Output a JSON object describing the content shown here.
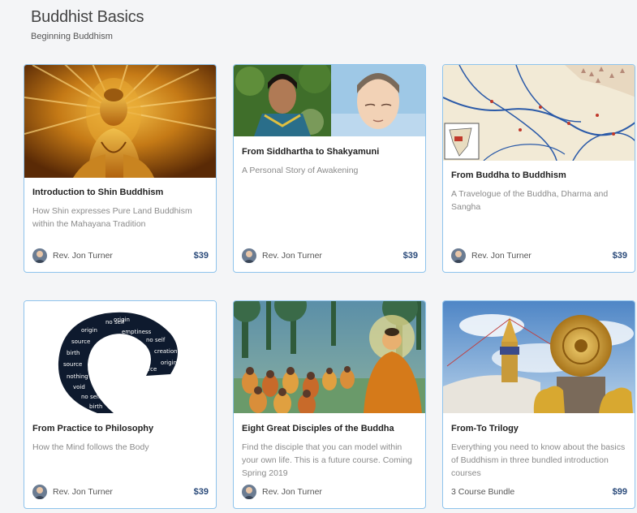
{
  "page": {
    "title": "Buddhist Basics",
    "subtitle": "Beginning Buddhism"
  },
  "courses": [
    {
      "title": "Introduction to Shin Buddhism",
      "description": "How Shin expresses Pure Land Buddhism within the Mahayana Tradition",
      "author": "Rev. Jon Turner",
      "price": "$39",
      "image": "golden-buddha-image"
    },
    {
      "title": "From Siddhartha to Shakyamuni",
      "description": "A Personal Story of Awakening",
      "author": "Rev. Jon Turner",
      "price": "$39",
      "image": "siddhartha-illustration-image"
    },
    {
      "title": "From Buddha to Buddhism",
      "description": "A Travelogue of the Buddha, Dharma and Sangha",
      "author": "Rev. Jon Turner",
      "price": "$39",
      "image": "ancient-india-map-image"
    },
    {
      "title": "From Practice to Philosophy",
      "description": "How the Mind follows the Body",
      "author": "Rev. Jon Turner",
      "price": "$39",
      "image": "enso-word-circle-image",
      "image_words": [
        "no self",
        "origin",
        "emptiness",
        "source",
        "no self",
        "birth",
        "creation",
        "source",
        "origin",
        "nothing",
        "void",
        "no self",
        "birth",
        "source",
        "origin"
      ]
    },
    {
      "title": "Eight Great Disciples of the Buddha",
      "description": "Find the disciple that you can model within your own life. This is a future course. Coming Spring 2019",
      "author": "Rev. Jon Turner",
      "price": "",
      "image": "disciples-painting-image"
    },
    {
      "title": "From-To Trilogy",
      "description": "Everything you need to know about the basics of Buddhism in three bundled introduction courses",
      "author": "3 Course Bundle",
      "price": "$99",
      "image": "stupa-dharma-wheel-image"
    }
  ],
  "colors": {
    "card_border": "#8ec3ec",
    "price": "#2a4a7a",
    "background": "#f4f5f7"
  }
}
